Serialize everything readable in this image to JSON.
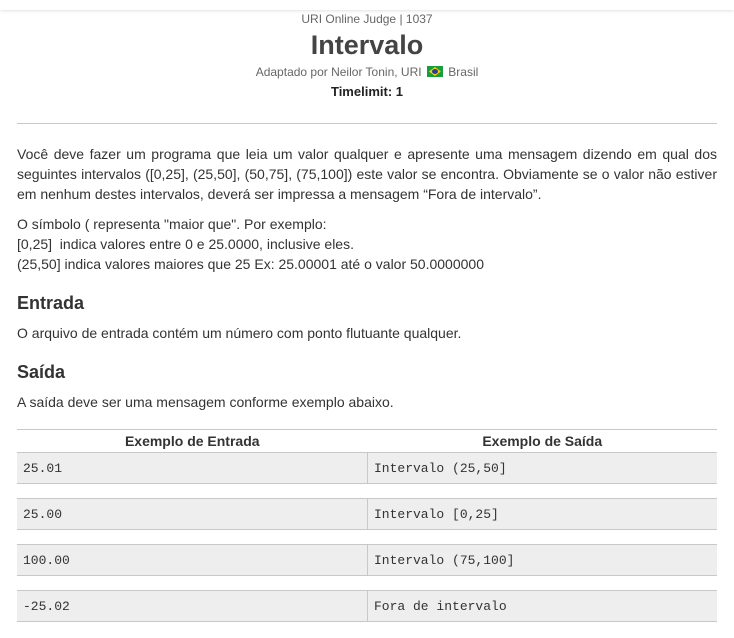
{
  "header": {
    "judge": "URI Online Judge | 1037",
    "title": "Intervalo",
    "author_prefix": "Adaptado por Neilor Tonin, URI",
    "country": "Brasil",
    "timelimit": "Timelimit: 1"
  },
  "description": {
    "paragraph1": "Você deve fazer um programa que leia um valor qualquer e apresente uma mensagem dizendo em qual dos seguintes intervalos ([0,25], (25,50], (50,75], (75,100]) este valor se encontra. Obviamente se o valor não estiver em nenhum destes intervalos, deverá ser impressa a mensagem “Fora de intervalo”.",
    "line1": "O símbolo ( representa \"maior que\". Por exemplo:",
    "line2": "[0,25]  indica valores entre 0 e 25.0000, inclusive eles.",
    "line3": "(25,50] indica valores maiores que 25 Ex: 25.00001 até o valor 50.0000000"
  },
  "input_section": {
    "heading": "Entrada",
    "text": "O arquivo de entrada contém um número com ponto flutuante qualquer."
  },
  "output_section": {
    "heading": "Saída",
    "text": "A saída deve ser uma mensagem conforme exemplo abaixo."
  },
  "samples": {
    "headers": [
      "Exemplo de Entrada",
      "Exemplo de Saída"
    ],
    "rows": [
      {
        "input": "25.01",
        "output": "Intervalo (25,50]"
      },
      {
        "input": "25.00",
        "output": "Intervalo [0,25]"
      },
      {
        "input": "100.00",
        "output": "Intervalo (75,100]"
      },
      {
        "input": "-25.02",
        "output": "Fora de intervalo"
      }
    ]
  },
  "icons": {
    "flag": "brazil-flag-icon"
  }
}
